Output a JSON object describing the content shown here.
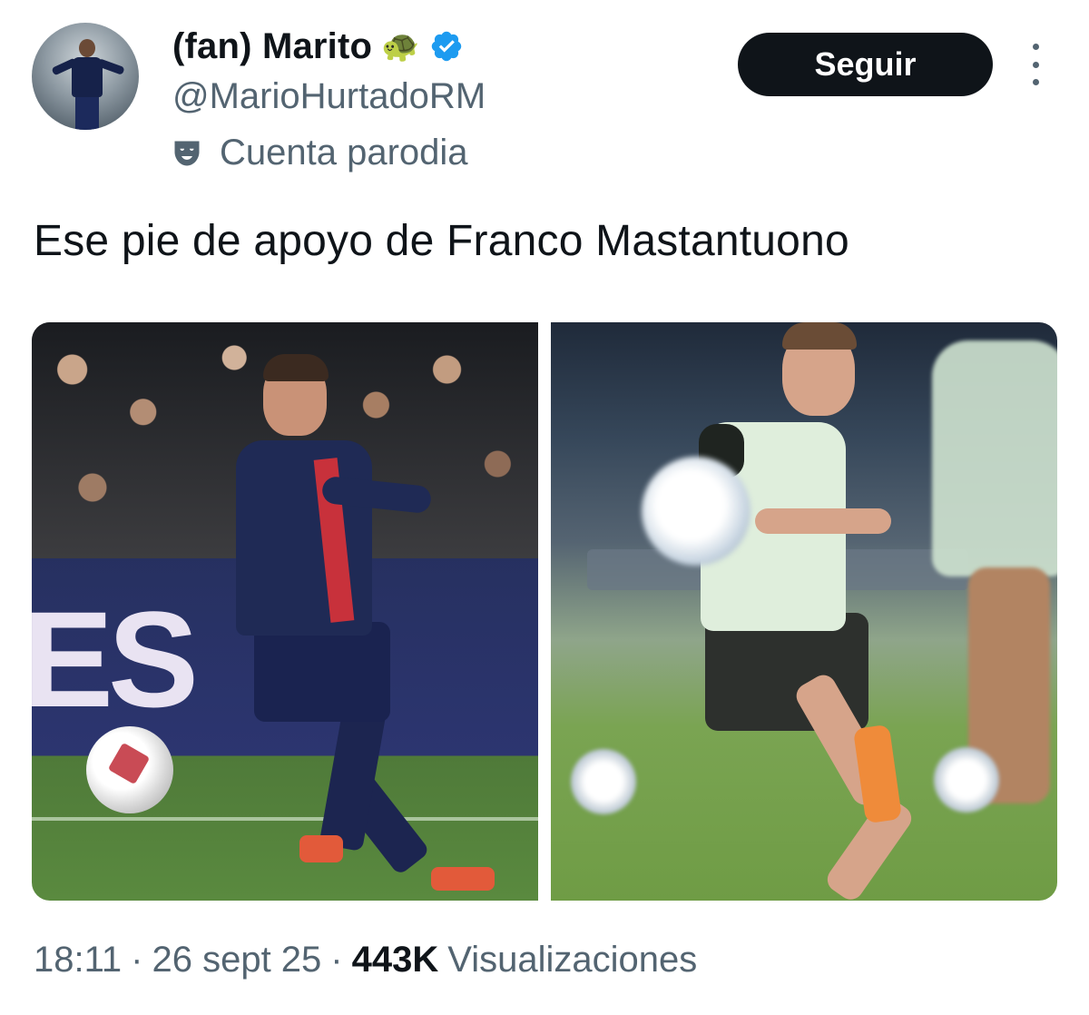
{
  "author": {
    "display_name": "(fan) Marito",
    "name_emoji": "🐢",
    "handle": "@MarioHurtadoRM",
    "account_label": "Cuenta parodia",
    "verified": true,
    "verified_color": "#1d9bf0"
  },
  "actions": {
    "follow_label": "Seguir",
    "more_icon": "more-vertical-icon"
  },
  "tweet": {
    "text": "Ese pie de apoyo de Franco Mastantuono",
    "media": [
      {
        "name": "photo-1",
        "description_icon": "image"
      },
      {
        "name": "photo-2",
        "description_icon": "image"
      }
    ],
    "time": "18:11",
    "separator": "·",
    "date": "26 sept 25",
    "views_count": "443K",
    "views_label": "Visualizaciones"
  },
  "colors": {
    "text_primary": "#0f1419",
    "text_secondary": "#536471",
    "button_bg": "#0f1419"
  }
}
